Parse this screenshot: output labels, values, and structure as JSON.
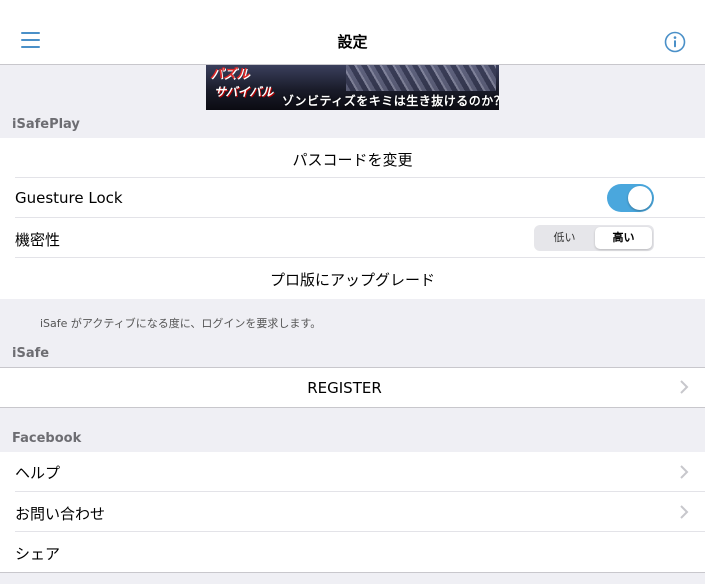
{
  "nav": {
    "title": "設定",
    "menu_icon": "hamburger-icon",
    "info_icon": "info-icon"
  },
  "banner": {
    "logo_line1": "パズル",
    "logo_line2": "サバイバル",
    "tagline": "ゾンビティズをキミは生き抜けるのか？"
  },
  "sections": {
    "isafeplay": {
      "header": "iSafePlay",
      "change_passcode": "パスコードを変更",
      "gesture_lock_label": "Guesture Lock",
      "gesture_lock_on": true,
      "secrecy_label": "機密性",
      "secrecy_options": [
        "低い",
        "高い"
      ],
      "secrecy_selected": "高い",
      "upgrade": "プロ版にアップグレード",
      "footer": "iSafe がアクティブになる度に、ログインを要求します。"
    },
    "isafe": {
      "header": "iSafe",
      "register": "REGISTER"
    },
    "facebook": {
      "header": "Facebook",
      "items": [
        "ヘルプ",
        "お問い合わせ",
        "シェア"
      ]
    }
  },
  "colors": {
    "accent": "#4a90c8",
    "toggle_on": "#4aa7dd",
    "background": "#efeff4"
  }
}
